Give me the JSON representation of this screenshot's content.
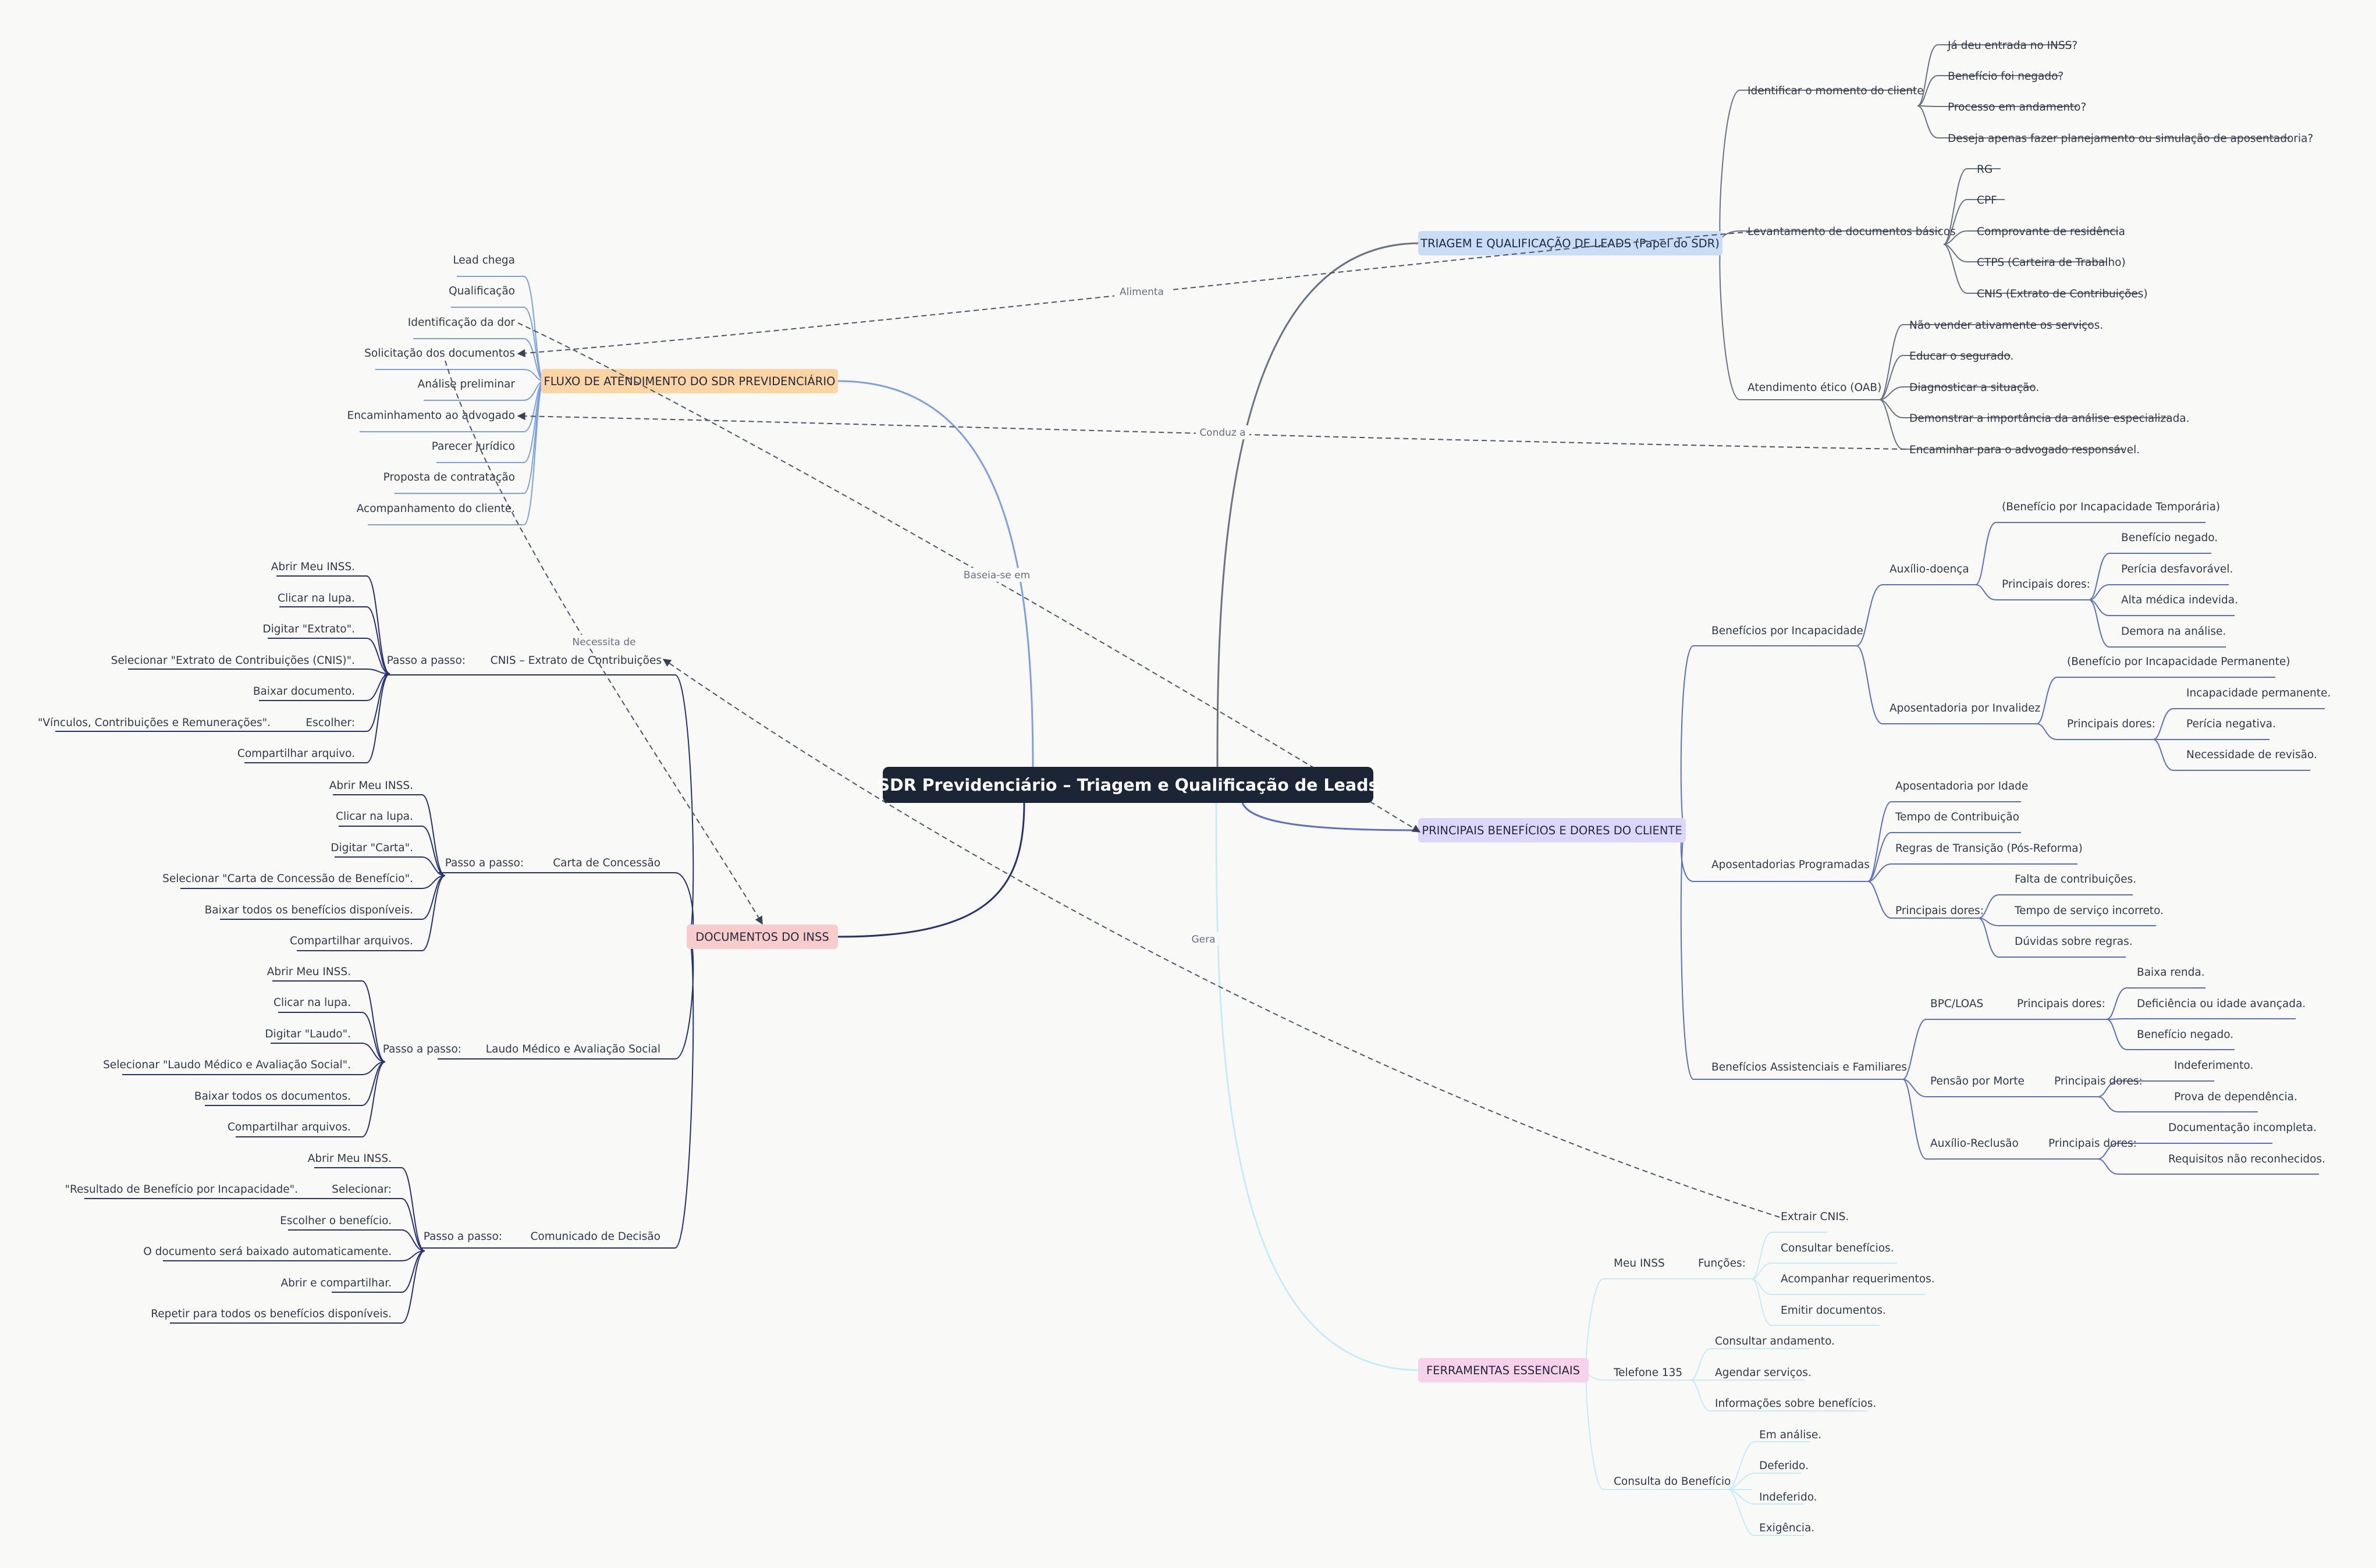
{
  "root": "SDR Previdenciário – Triagem e Qualificação de Leads",
  "colors": {
    "background": "#f9f9f8",
    "root": "#1b2535",
    "triagem": "#c9dcf8",
    "fluxo": "#fdd4a4",
    "beneficios": "#dcd7fa",
    "documentos": "#f9cccc",
    "ferramentas": "#f8d2ea"
  },
  "branches": {
    "fluxo": {
      "title": "FLUXO DE ATENDIMENTO DO SDR PREVIDENCIÁRIO",
      "items": [
        "Lead chega",
        "Qualificação",
        "Identificação da dor",
        "Solicitação dos documentos",
        "Análise preliminar",
        "Encaminhamento ao advogado",
        "Parecer jurídico",
        "Proposta de contratação",
        "Acompanhamento do cliente."
      ]
    },
    "triagem": {
      "title": "TRIAGEM E QUALIFICAÇÃO DE LEADS (Papel do SDR)",
      "identificar": {
        "label": "Identificar o momento do cliente",
        "items": [
          "Já deu entrada no INSS?",
          "Benefício foi negado?",
          "Processo em andamento?",
          "Deseja apenas fazer planejamento ou simulação de aposentadoria?"
        ]
      },
      "levantamento": {
        "label": "Levantamento de documentos básicos",
        "items": [
          "RG",
          "CPF",
          "Comprovante de residência",
          "CTPS (Carteira de Trabalho)",
          "CNIS (Extrato de Contribuições)"
        ]
      },
      "etico": {
        "label": "Atendimento ético (OAB)",
        "items": [
          "Não vender ativamente os serviços.",
          "Educar o segurado.",
          "Diagnosticar a situação.",
          "Demonstrar a importância da análise especializada.",
          "Encaminhar para o advogado responsável."
        ]
      }
    },
    "beneficios": {
      "title": "PRINCIPAIS BENEFÍCIOS E DORES DO CLIENTE",
      "incapacidade": {
        "label": "Benefícios por Incapacidade",
        "auxilio": {
          "label": "Auxílio-doença",
          "desc": "(Benefício por Incapacidade Temporária)",
          "dores_label": "Principais dores:",
          "dores": [
            "Benefício negado.",
            "Perícia desfavorável.",
            "Alta médica indevida.",
            "Demora na análise."
          ]
        },
        "invalidez": {
          "label": "Aposentadoria por Invalidez",
          "desc": "(Benefício por Incapacidade Permanente)",
          "dores_label": "Principais dores:",
          "dores": [
            "Incapacidade permanente.",
            "Perícia negativa.",
            "Necessidade de revisão."
          ]
        }
      },
      "programadas": {
        "label": "Aposentadorias Programadas",
        "items": [
          "Aposentadoria por Idade",
          "Tempo de Contribuição",
          "Regras de Transição (Pós-Reforma)"
        ],
        "dores_label": "Principais dores:",
        "dores": [
          "Falta de contribuições.",
          "Tempo de serviço incorreto.",
          "Dúvidas sobre regras."
        ]
      },
      "assistenciais": {
        "label": "Benefícios Assistenciais e Familiares",
        "bpc": {
          "label": "BPC/LOAS",
          "dores_label": "Principais dores:",
          "dores": [
            "Baixa renda.",
            "Deficiência ou idade avançada.",
            "Benefício negado."
          ]
        },
        "pensao": {
          "label": "Pensão por Morte",
          "dores_label": "Principais dores:",
          "dores": [
            "Indeferimento.",
            "Prova de dependência."
          ]
        },
        "reclusao": {
          "label": "Auxílio-Reclusão",
          "dores_label": "Principais dores:",
          "dores": [
            "Documentação incompleta.",
            "Requisitos não reconhecidos."
          ]
        }
      }
    },
    "documentos": {
      "title": "DOCUMENTOS DO INSS",
      "cnis": {
        "label": "CNIS – Extrato de Contribuições",
        "passo": "Passo a passo:",
        "steps": [
          "Abrir Meu INSS.",
          "Clicar na lupa.",
          "Digitar \"Extrato\".",
          "Selecionar \"Extrato de Contribuições (CNIS)\".",
          "Baixar documento.",
          "Escolher:",
          "Compartilhar arquivo."
        ],
        "escolher_value": "\"Vínculos, Contribuições e Remunerações\"."
      },
      "carta": {
        "label": "Carta de Concessão",
        "passo": "Passo a passo:",
        "steps": [
          "Abrir Meu INSS.",
          "Clicar na lupa.",
          "Digitar \"Carta\".",
          "Selecionar \"Carta de Concessão de Benefício\".",
          "Baixar todos os benefícios disponíveis.",
          "Compartilhar arquivos."
        ]
      },
      "laudo": {
        "label": "Laudo Médico e Avaliação Social",
        "passo": "Passo a passo:",
        "steps": [
          "Abrir Meu INSS.",
          "Clicar na lupa.",
          "Digitar \"Laudo\".",
          "Selecionar \"Laudo Médico e Avaliação Social\".",
          "Baixar todos os documentos.",
          "Compartilhar arquivos."
        ]
      },
      "comunicado": {
        "label": "Comunicado de Decisão",
        "passo": "Passo a passo:",
        "steps": [
          "Abrir Meu INSS.",
          "Selecionar:",
          "Escolher o benefício.",
          "O documento será baixado automaticamente.",
          "Abrir e compartilhar.",
          "Repetir para todos os benefícios disponíveis."
        ],
        "selecionar_value": "\"Resultado de Benefício por Incapacidade\"."
      }
    },
    "ferramentas": {
      "title": "FERRAMENTAS ESSENCIAIS",
      "meu_inss": {
        "label": "Meu INSS",
        "funcoes_label": "Funções:",
        "items": [
          "Extrair CNIS.",
          "Consultar benefícios.",
          "Acompanhar requerimentos.",
          "Emitir documentos."
        ]
      },
      "telefone": {
        "label": "Telefone 135",
        "items": [
          "Consultar andamento.",
          "Agendar serviços.",
          "Informações sobre benefícios."
        ]
      },
      "consulta": {
        "label": "Consulta do Benefício",
        "items": [
          "Em análise.",
          "Deferido.",
          "Indeferido.",
          "Exigência."
        ]
      }
    }
  },
  "relations": [
    "Alimenta",
    "Conduz a",
    "Baseia-se em",
    "Necessita de",
    "Gera"
  ]
}
